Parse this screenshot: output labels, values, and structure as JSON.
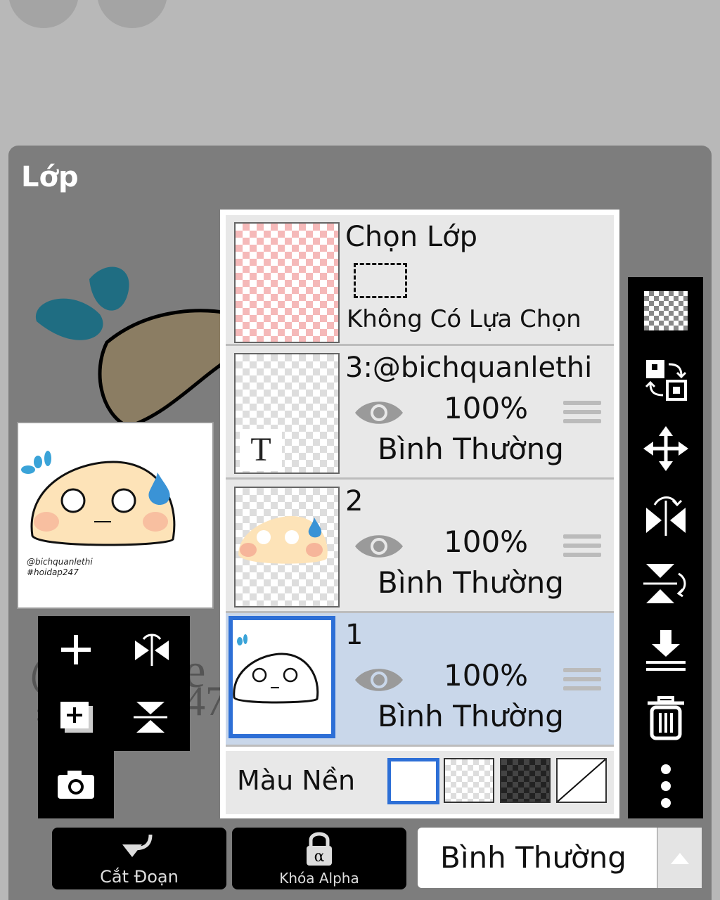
{
  "panel": {
    "title": "Lớp"
  },
  "selection": {
    "title": "Chọn Lớp",
    "status": "Không Có Lựa Chọn"
  },
  "layers": [
    {
      "name": "3:@bichquanlethi",
      "opacity": "100%",
      "blend": "Bình Thường",
      "thumb_glyph": "T",
      "selected": false
    },
    {
      "name": "2",
      "opacity": "100%",
      "blend": "Bình Thường",
      "selected": false
    },
    {
      "name": "1",
      "opacity": "100%",
      "blend": "Bình Thường",
      "selected": true
    }
  ],
  "background": {
    "label": "Màu Nền",
    "options": [
      "white",
      "transparent",
      "dark-checker",
      "none"
    ],
    "selected": "white"
  },
  "thumbnail": {
    "signature_line1": "@bichquanlethi",
    "signature_line2": "#hoidap247"
  },
  "bottom_bar": {
    "clip_label": "Cắt Đoạn",
    "alpha_lock_label": "Khóa Alpha",
    "blend_mode": "Bình Thường"
  },
  "colors": {
    "panel": "#7d7d7d",
    "selected_row": "#c9d7ea",
    "accent_blue": "#2d6fd6",
    "toolbar": "#000000"
  }
}
